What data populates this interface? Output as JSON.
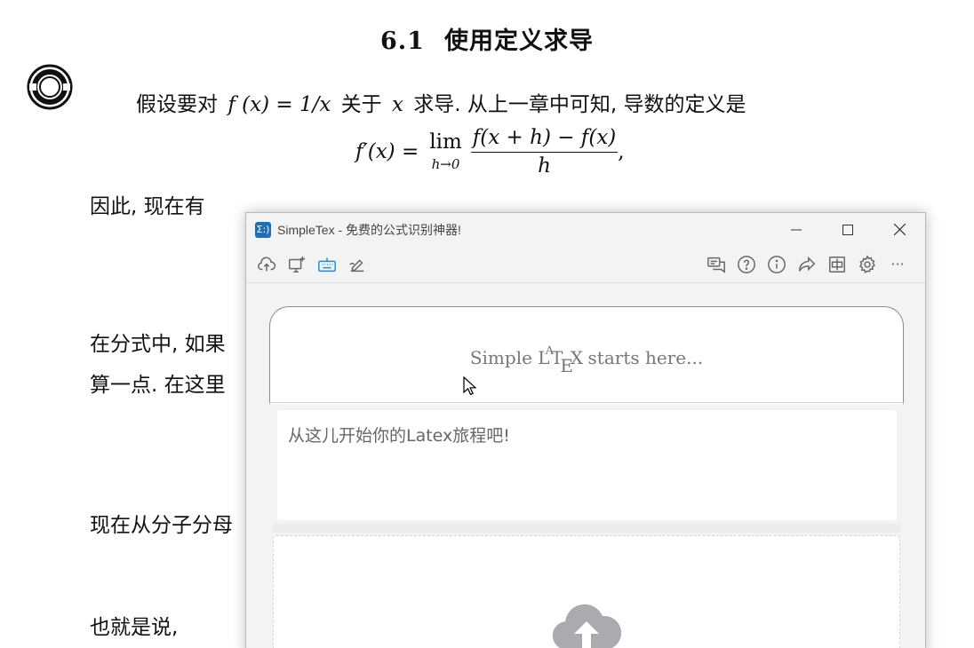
{
  "document": {
    "section_number": "6.1",
    "section_title": "使用定义求导",
    "para1_a": "假设要对",
    "para1_math": "f (x) = 1/x",
    "para1_b": "关于",
    "para1_var": "x",
    "para1_c": "求导. 从上一章中可知, 导数的定义是",
    "eq_lhs": "f′(x) =",
    "eq_lim": "lim",
    "eq_lim_sub": "h→0",
    "eq_numerator": "f(x + h) − f(x)",
    "eq_denominator": "h",
    "eq_trail": ",",
    "para2": "因此, 现在有",
    "para3": "在分式中, 如果",
    "para4": "算一点. 在这里",
    "para5": "现在从分子分母",
    "para6": "也就是说,"
  },
  "window": {
    "logo_text": "Σ:)",
    "title": "SimpleTex - 免费的公式识别神器!",
    "minimize": "—",
    "maximize": "☐",
    "close": "✕"
  },
  "toolbar": {
    "left_icons": [
      "cloud-upload-icon",
      "screenshot-icon",
      "keyboard-icon",
      "handwrite-icon"
    ],
    "right_icons": [
      "feedback-icon",
      "help-icon",
      "info-icon",
      "share-icon",
      "layout-icon",
      "settings-icon",
      "more-icon"
    ],
    "more_label": "···"
  },
  "preview": {
    "text_prefix": "Simple",
    "latex_logo": "LATEX",
    "text_suffix": "starts here..."
  },
  "editor": {
    "placeholder": "从这儿开始你的Latex旅程吧!"
  },
  "colors": {
    "accent": "#1f6fb6",
    "window_bg": "#f3f3f3",
    "upload_icon": "#a9abb0"
  }
}
